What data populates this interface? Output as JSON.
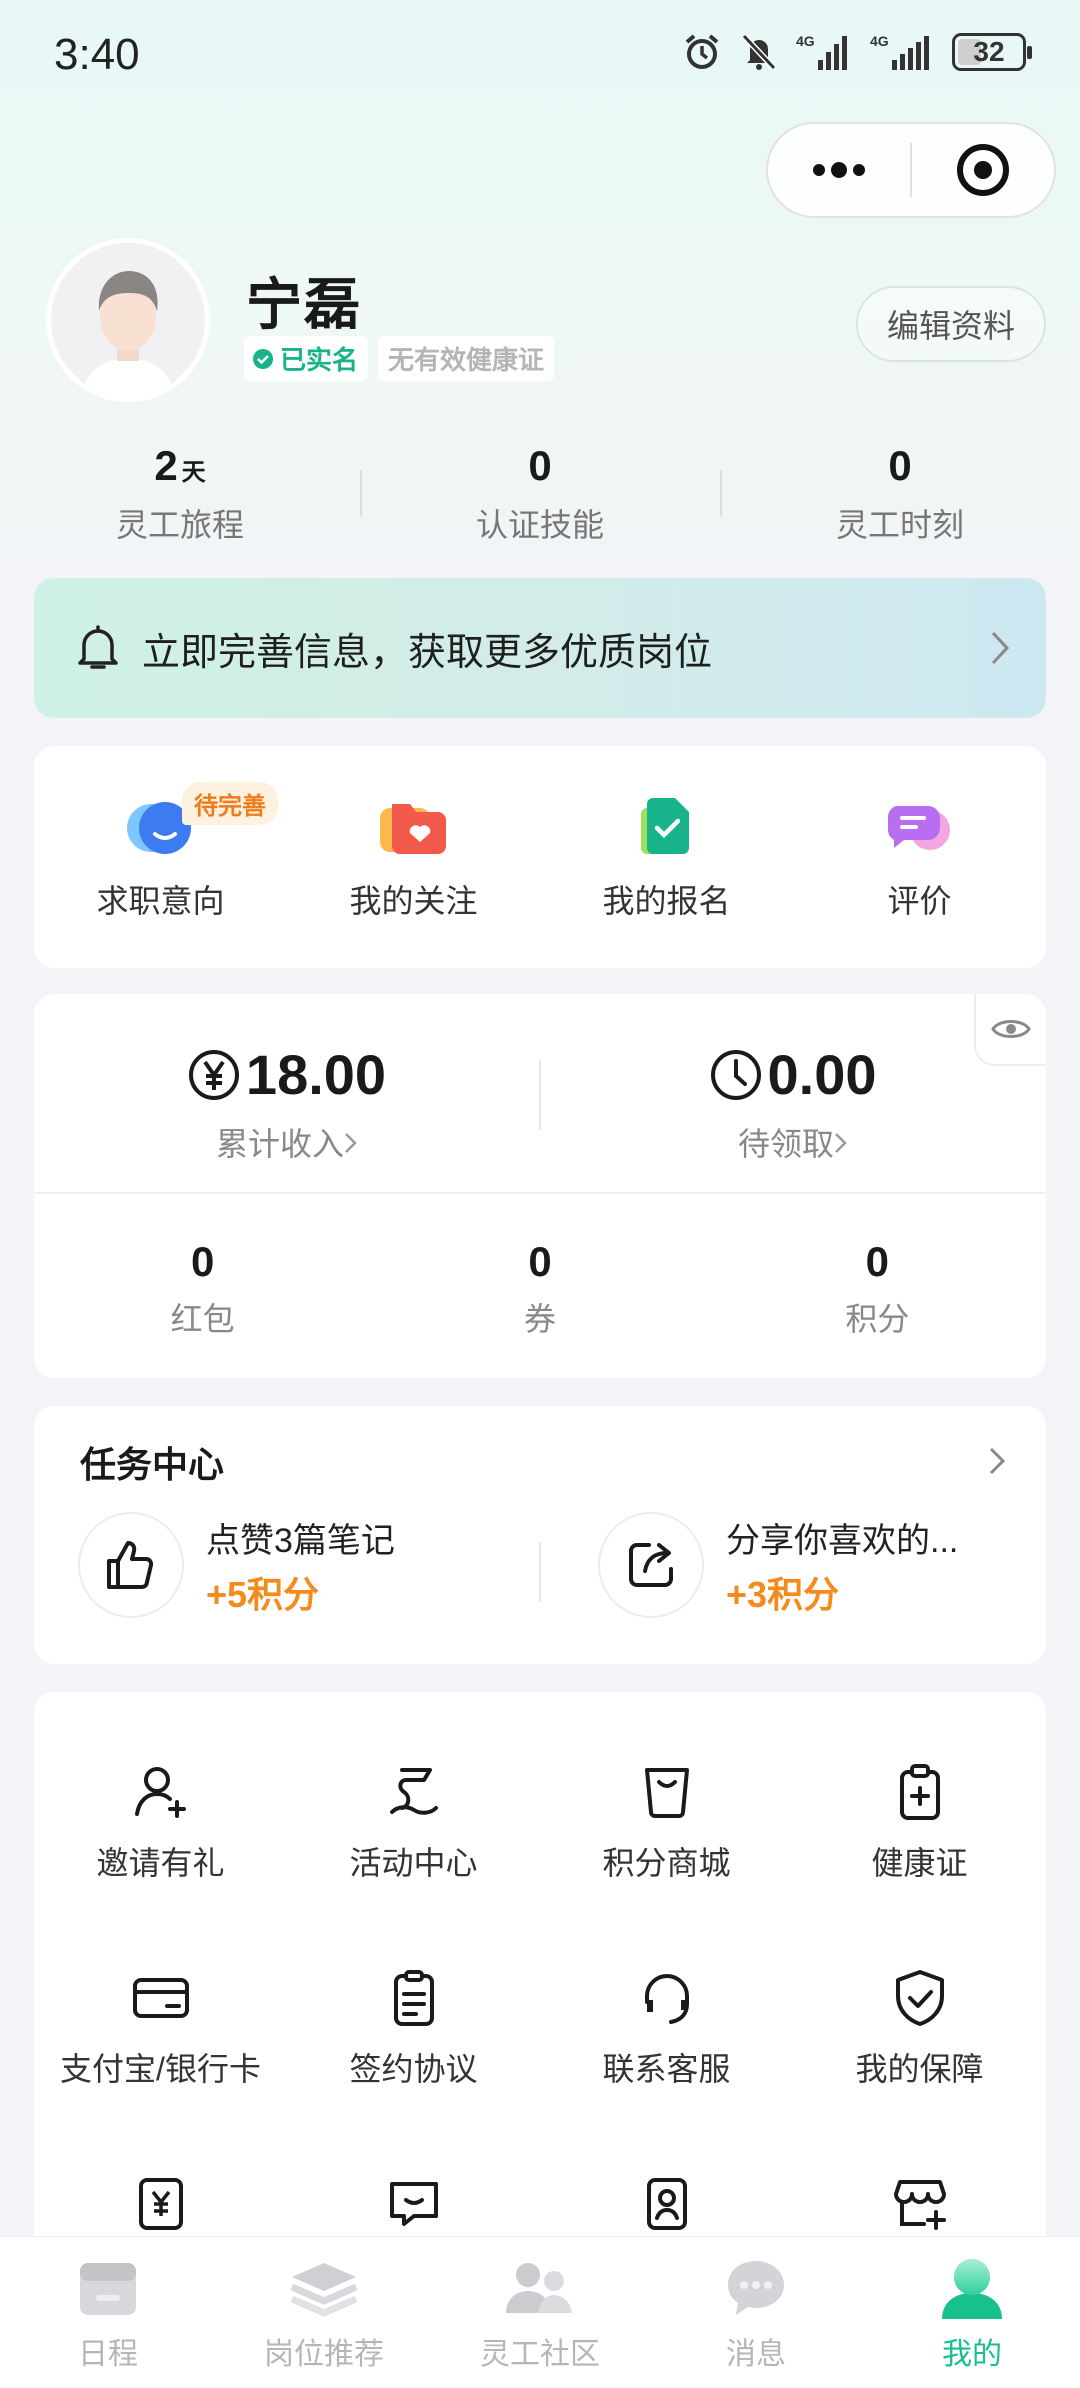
{
  "status_bar": {
    "time": "3:40",
    "network_1": "4G",
    "network_2": "4G",
    "battery": "32"
  },
  "profile": {
    "name": "宁磊",
    "verified_label": "已实名",
    "health_cert_label": "无有效健康证",
    "edit_label": "编辑资料"
  },
  "stats": [
    {
      "value": "2",
      "unit": "天",
      "label": "灵工旅程"
    },
    {
      "value": "0",
      "unit": "",
      "label": "认证技能"
    },
    {
      "value": "0",
      "unit": "",
      "label": "灵工时刻"
    }
  ],
  "banner": {
    "text": "立即完善信息，获取更多优质岗位"
  },
  "quick_actions": [
    {
      "label": "求职意向",
      "tag": "待完善",
      "icon": "job-intent-icon"
    },
    {
      "label": "我的关注",
      "icon": "favorites-icon"
    },
    {
      "label": "我的报名",
      "icon": "applications-icon"
    },
    {
      "label": "评价",
      "icon": "review-icon"
    }
  ],
  "money": {
    "total_income": {
      "value": "18.00",
      "label": "累计收入"
    },
    "pending": {
      "value": "0.00",
      "label": "待领取"
    }
  },
  "wallet": [
    {
      "value": "0",
      "label": "红包"
    },
    {
      "value": "0",
      "label": "券"
    },
    {
      "value": "0",
      "label": "积分"
    }
  ],
  "task_center": {
    "title": "任务中心",
    "tasks": [
      {
        "name": "点赞3篇笔记",
        "reward": "+5积分",
        "icon": "thumbs-up-icon"
      },
      {
        "name": "分享你喜欢的...",
        "reward": "+3积分",
        "icon": "share-icon"
      }
    ]
  },
  "tools": [
    {
      "label": "邀请有礼",
      "icon": "invite-user-icon"
    },
    {
      "label": "活动中心",
      "icon": "activity-flag-icon"
    },
    {
      "label": "积分商城",
      "icon": "shopping-bag-icon"
    },
    {
      "label": "健康证",
      "icon": "health-cert-icon"
    },
    {
      "label": "支付宝/银行卡",
      "icon": "bank-card-icon"
    },
    {
      "label": "签约协议",
      "icon": "contract-icon"
    },
    {
      "label": "联系客服",
      "icon": "headset-icon"
    },
    {
      "label": "我的保障",
      "icon": "shield-check-icon"
    },
    {
      "label": "",
      "icon": "yen-wallet-icon"
    },
    {
      "label": "",
      "icon": "chat-smile-icon"
    },
    {
      "label": "",
      "icon": "id-card-icon"
    },
    {
      "label": "",
      "icon": "store-add-icon"
    }
  ],
  "tabbar": [
    {
      "label": "日程",
      "icon": "calendar-icon"
    },
    {
      "label": "岗位推荐",
      "icon": "layers-icon"
    },
    {
      "label": "灵工社区",
      "icon": "community-icon"
    },
    {
      "label": "消息",
      "icon": "message-icon"
    },
    {
      "label": "我的",
      "icon": "profile-icon",
      "active": true
    }
  ],
  "colors": {
    "accent": "#17c08d",
    "reward": "#f58a1d",
    "tag": "#f07b1c"
  }
}
